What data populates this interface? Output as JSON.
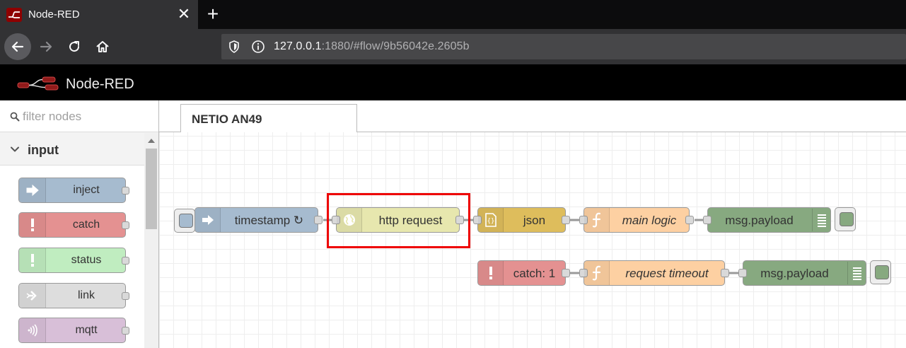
{
  "browser": {
    "tab_title": "Node-RED",
    "close_glyph": "✕",
    "new_tab_glyph": "+",
    "url_host": "127.0.0.1",
    "url_rest": ":1880/#flow/9b56042e.2605b"
  },
  "header": {
    "title": "Node-RED"
  },
  "palette": {
    "search_placeholder": "filter nodes",
    "category": "input",
    "items": [
      {
        "label": "inject",
        "color": "#a6bbcf",
        "icon": "arrow-icon"
      },
      {
        "label": "catch",
        "color": "#e49191",
        "icon": "exclamation-icon"
      },
      {
        "label": "status",
        "color": "#c0edc0",
        "icon": "exclamation-icon"
      },
      {
        "label": "link",
        "color": "#dddddd",
        "icon": "link-arrow-icon"
      },
      {
        "label": "mqtt",
        "color": "#d8bfd8",
        "icon": "wave-icon"
      }
    ]
  },
  "workspace": {
    "tab_label": "NETIO AN49",
    "nodes": {
      "timestamp": {
        "label": "timestamp ↻",
        "color": "#a6bbcf"
      },
      "http_request": {
        "label": "http request",
        "color": "#e7e7ae"
      },
      "json": {
        "label": "json",
        "color": "#debd5c"
      },
      "main_logic": {
        "label": "main logic",
        "color": "#fdd0a2"
      },
      "debug1": {
        "label": "msg.payload",
        "color": "#87a980"
      },
      "catch": {
        "label": "catch: 1",
        "color": "#e49191"
      },
      "request_timeout": {
        "label": "request timeout",
        "color": "#fdd0a2"
      },
      "debug2": {
        "label": "msg.payload",
        "color": "#87a980"
      }
    }
  }
}
